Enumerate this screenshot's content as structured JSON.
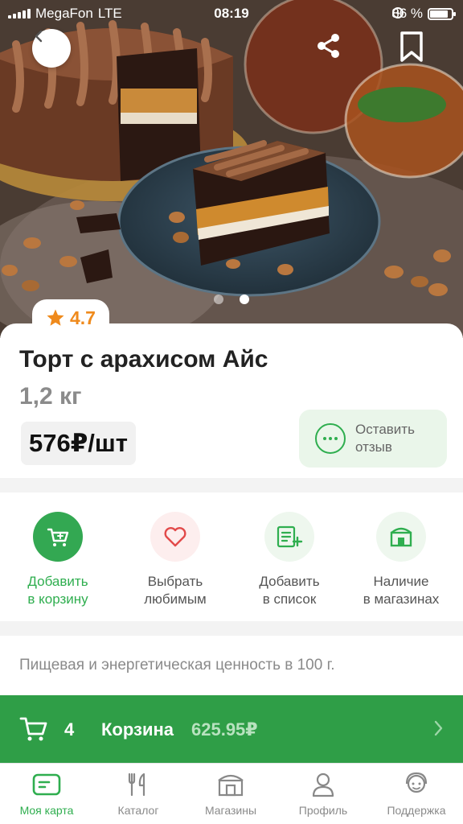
{
  "status_bar": {
    "carrier": "MegaFon",
    "network": "LTE",
    "time": "08:19",
    "battery": "86 %"
  },
  "hero": {
    "pages": 2,
    "active_page": 2
  },
  "product": {
    "rating": "4.7",
    "title": "Торт с арахисом Айс",
    "weight": "1,2 кг",
    "price": "576₽/шт",
    "review_button": "Оставить\nотзыв"
  },
  "actions": [
    {
      "label": "Добавить\nв корзину",
      "icon": "cart-icon"
    },
    {
      "label": "Выбрать\nлюбимым",
      "icon": "heart-icon"
    },
    {
      "label": "Добавить\nв список",
      "icon": "list-add-icon"
    },
    {
      "label": "Наличие\nв магазинах",
      "icon": "store-icon"
    }
  ],
  "nutrition": {
    "heading": "Пищевая и энергетическая ценность в 100 г."
  },
  "cart": {
    "count": "4",
    "label": "Корзина",
    "total": "625.95₽"
  },
  "tabs": [
    {
      "label": "Моя карта",
      "icon": "card-icon",
      "active": true
    },
    {
      "label": "Каталог",
      "icon": "cutlery-icon",
      "active": false
    },
    {
      "label": "Магазины",
      "icon": "store-icon",
      "active": false
    },
    {
      "label": "Профиль",
      "icon": "profile-icon",
      "active": false
    },
    {
      "label": "Поддержка",
      "icon": "support-icon",
      "active": false
    }
  ],
  "colors": {
    "accent": "#2fae4f",
    "cart_bar": "#2f9e47",
    "rating": "#ef8a1c"
  }
}
